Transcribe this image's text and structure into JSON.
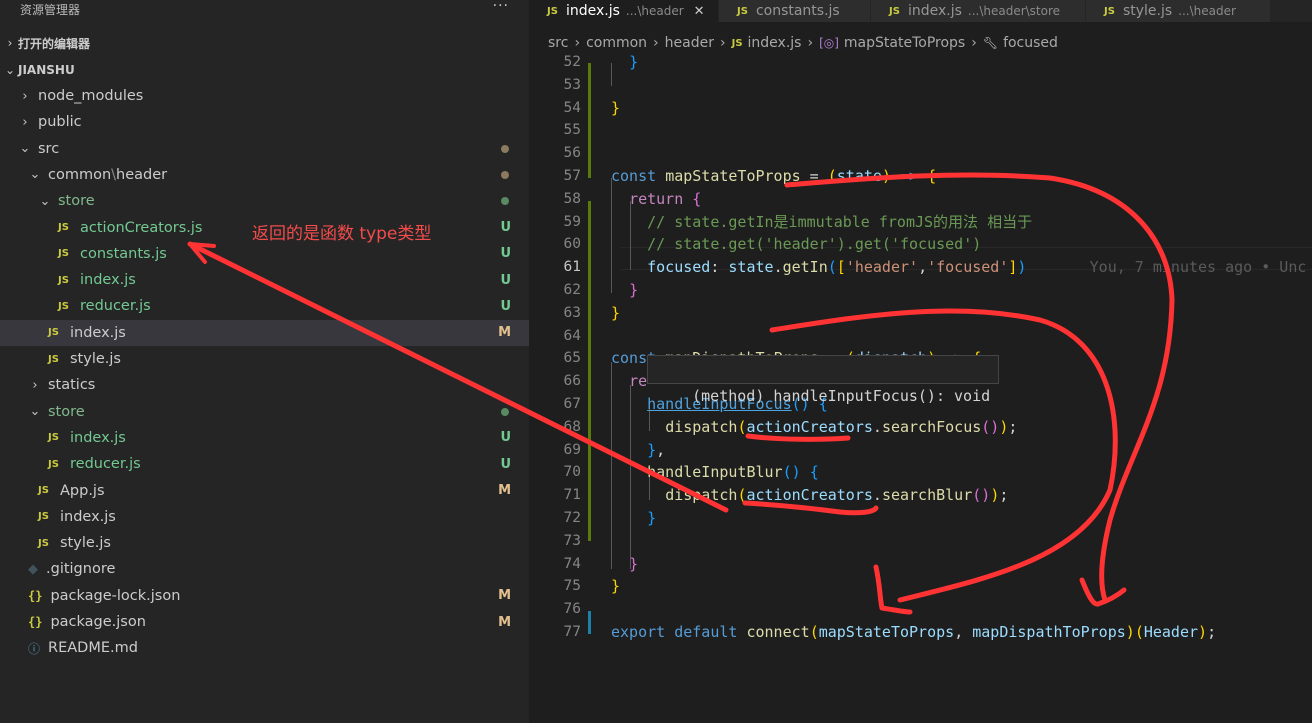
{
  "sidebar": {
    "title": "资源管理器",
    "more": "···",
    "open_editors": "打开的编辑器",
    "project": "JIANSHU",
    "items": [
      {
        "label": "node_modules",
        "kind": "folder",
        "open": false,
        "indent": 0,
        "status": ""
      },
      {
        "label": "public",
        "kind": "folder",
        "open": false,
        "indent": 0,
        "status": ""
      },
      {
        "label": "src",
        "kind": "folder",
        "open": true,
        "indent": 0,
        "status": "dot"
      },
      {
        "label": "common",
        "label2": "header",
        "kind": "folder",
        "open": true,
        "indent": 1,
        "status": "dot"
      },
      {
        "label": "store",
        "kind": "folder",
        "open": true,
        "indent": 2,
        "status": "dotg",
        "green": true
      },
      {
        "label": "actionCreators.js",
        "kind": "js",
        "indent": 3,
        "status": "U",
        "green": true
      },
      {
        "label": "constants.js",
        "kind": "js",
        "indent": 3,
        "status": "U",
        "green": true
      },
      {
        "label": "index.js",
        "kind": "js",
        "indent": 3,
        "status": "U",
        "green": true
      },
      {
        "label": "reducer.js",
        "kind": "js",
        "indent": 3,
        "status": "U",
        "green": true
      },
      {
        "label": "index.js",
        "kind": "js",
        "indent": 2,
        "status": "M",
        "active": true
      },
      {
        "label": "style.js",
        "kind": "js",
        "indent": 2,
        "status": ""
      },
      {
        "label": "statics",
        "kind": "folder",
        "open": false,
        "indent": 1,
        "status": ""
      },
      {
        "label": "store",
        "kind": "folder",
        "open": true,
        "indent": 1,
        "status": "dotg",
        "green": true
      },
      {
        "label": "index.js",
        "kind": "js",
        "indent": 2,
        "status": "U",
        "green": true
      },
      {
        "label": "reducer.js",
        "kind": "js",
        "indent": 2,
        "status": "U",
        "green": true
      },
      {
        "label": "App.js",
        "kind": "js",
        "indent": 1,
        "status": "M"
      },
      {
        "label": "index.js",
        "kind": "js",
        "indent": 1,
        "status": ""
      },
      {
        "label": "style.js",
        "kind": "js",
        "indent": 1,
        "status": ""
      },
      {
        "label": ".gitignore",
        "kind": "git",
        "indent": 0,
        "status": ""
      },
      {
        "label": "package-lock.json",
        "kind": "json",
        "indent": 0,
        "status": "M"
      },
      {
        "label": "package.json",
        "kind": "json",
        "indent": 0,
        "status": "M"
      },
      {
        "label": "README.md",
        "kind": "info",
        "indent": 0,
        "status": ""
      }
    ],
    "annotation": "返回的是函数 type类型"
  },
  "tabs": [
    {
      "name": "index.js",
      "desc": "...\\header",
      "active": true,
      "close": "✕"
    },
    {
      "name": "constants.js",
      "desc": "",
      "active": false
    },
    {
      "name": "index.js",
      "desc": "...\\header\\store",
      "active": false
    },
    {
      "name": "style.js",
      "desc": "...\\header",
      "active": false
    }
  ],
  "breadcrumb": [
    "src",
    "common",
    "header",
    "index.js",
    "mapStateToProps",
    "focused"
  ],
  "code": {
    "lines": [
      52,
      53,
      54,
      55,
      56,
      57,
      58,
      59,
      60,
      61,
      62,
      63,
      64,
      65,
      66,
      67,
      68,
      69,
      70,
      71,
      72,
      73,
      74,
      75,
      76,
      77
    ],
    "hover": "(method) handleInputFocus(): void",
    "blame": "You, 7 minutes ago • Unc"
  }
}
